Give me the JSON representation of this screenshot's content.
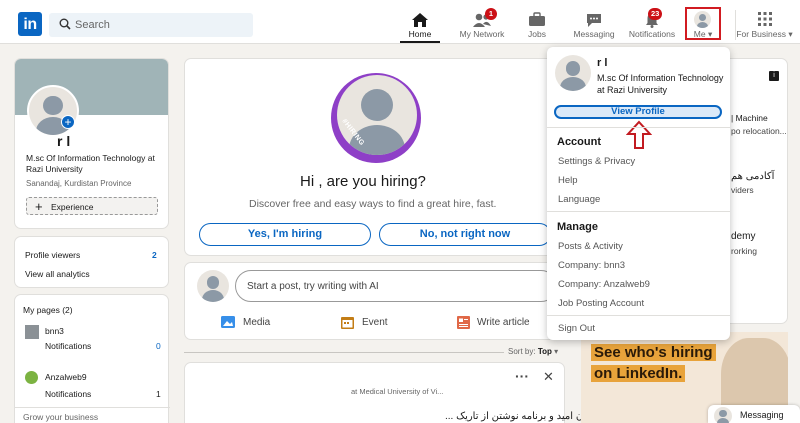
{
  "header": {
    "logo": "in",
    "search_placeholder": "Search",
    "nav": [
      {
        "label": "Home"
      },
      {
        "label": "My Network",
        "badge": "1"
      },
      {
        "label": "Jobs"
      },
      {
        "label": "Messaging"
      },
      {
        "label": "Notifications",
        "badge": "23"
      },
      {
        "label": "Me"
      },
      {
        "label": "For Business"
      }
    ]
  },
  "profile": {
    "name": "r                l",
    "headline": "M.sc Of Information Technology at Razi University",
    "location": "Sanandaj, Kurdistan Province",
    "experience_label": "Experience"
  },
  "analytics": {
    "profile_viewers_label": "Profile viewers",
    "profile_viewers_count": "2",
    "view_all": "View all analytics"
  },
  "pages": {
    "title": "My pages (2)",
    "items": [
      {
        "name": "bnn3",
        "notifications_label": "Notifications",
        "count": "0"
      },
      {
        "name": "Anzalweb9",
        "notifications_label": "Notifications",
        "count": "1"
      }
    ],
    "grow": "Grow your business"
  },
  "hiring": {
    "badge": "#HIRING",
    "title": "Hi       , are you hiring?",
    "subtitle": "Discover free and easy ways to find a great hire, fast.",
    "yes": "Yes, I'm hiring",
    "no": "No, not right now"
  },
  "composer": {
    "placeholder": "Start a post, try writing with AI",
    "media": "Media",
    "event": "Event",
    "article": "Write article"
  },
  "feed": {
    "sort_label": "Sort by:",
    "sort_value": "Top",
    "post_meta": "at Medical University of Vi...",
    "post_text": "باش بتلاشان امید و برنامه نوشتن از تاریک ..."
  },
  "right_partial": {
    "line1": "| Machine",
    "line2": "po relocation...",
    "line3": "آکادمی هم",
    "line4": "viders",
    "line5": "demy",
    "line6": "rorking"
  },
  "dropdown": {
    "name": "r                l",
    "headline": "M.sc Of Information Technology at Razi University",
    "view_profile": "View Profile",
    "account_title": "Account",
    "account_items": [
      "Settings & Privacy",
      "Help",
      "Language"
    ],
    "manage_title": "Manage",
    "manage_items": [
      "Posts & Activity",
      "Company: bnn3",
      "Company: Anzalweb9",
      "Job Posting Account"
    ],
    "sign_out": "Sign Out"
  },
  "promo": {
    "line1": "See who's hiring",
    "line2": "on LinkedIn."
  },
  "messaging_label": "Messaging",
  "colors": {
    "brand": "#0a66c2",
    "badge": "#cc1016",
    "highlight": "#d11b21",
    "promo_orange": "#e8a33b"
  }
}
